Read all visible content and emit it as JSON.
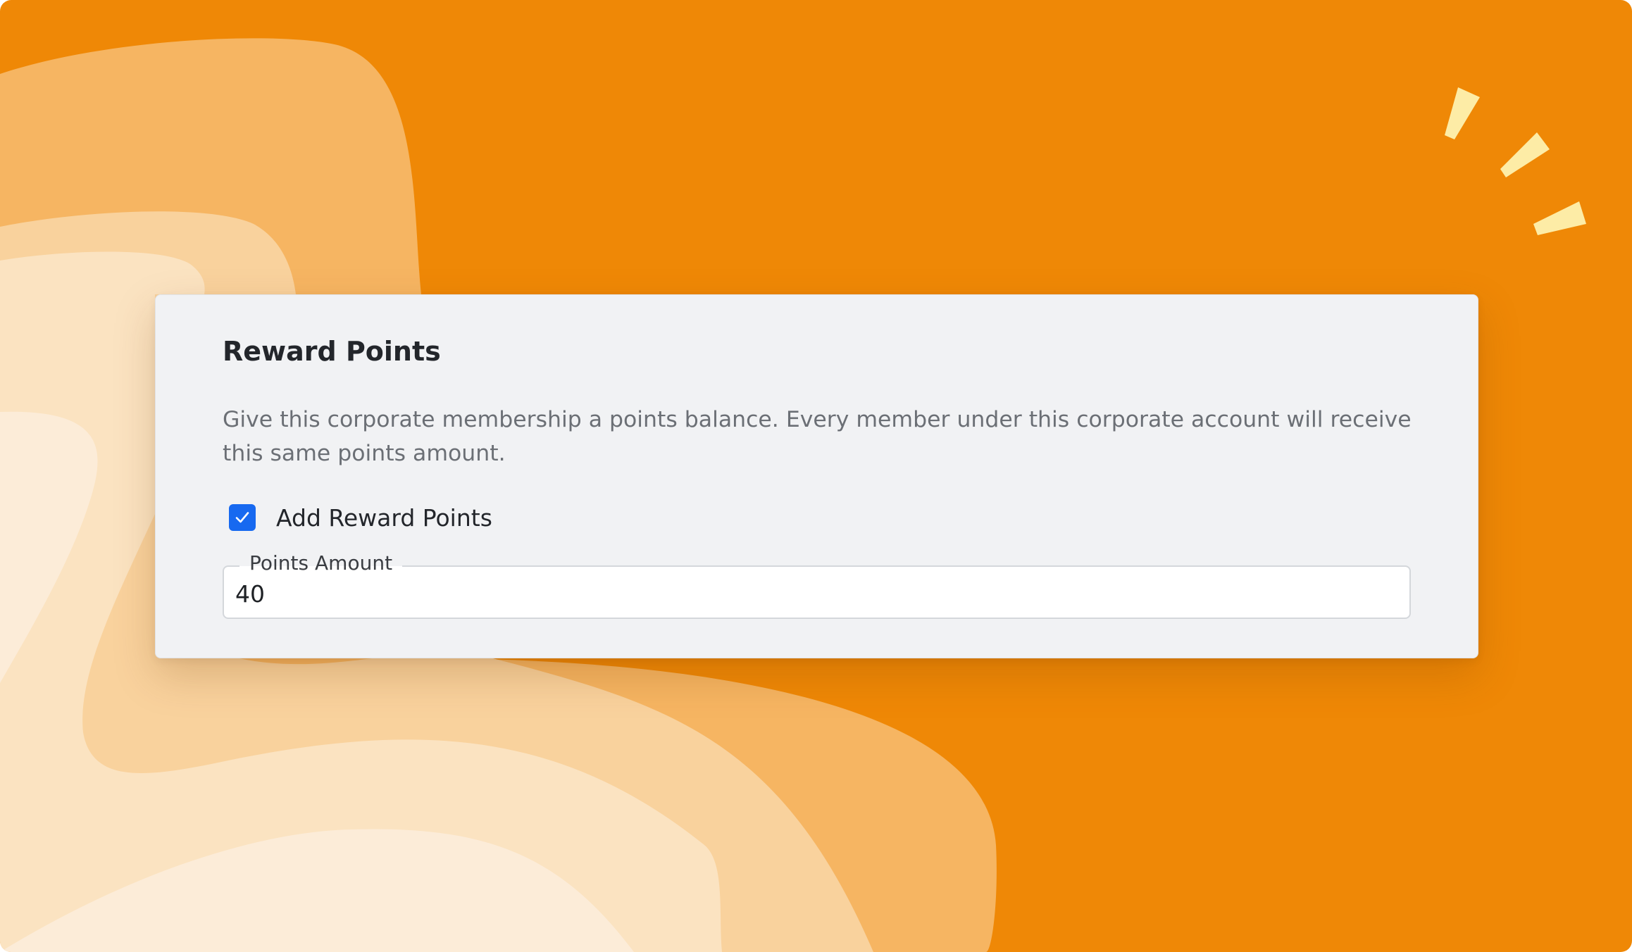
{
  "colors": {
    "background": "#ef8806",
    "card": "#f1f2f4",
    "accent": "#1769f0",
    "sparkle": "#fdeca6"
  },
  "card": {
    "title": "Reward Points",
    "description": "Give this corporate membership a points balance. Every member under this corporate account will receive this same points amount."
  },
  "add_points": {
    "label": "Add Reward Points",
    "checked": true
  },
  "points_amount": {
    "label": "Points Amount",
    "value": "40"
  },
  "icons": {
    "checkbox": "checkmark-icon",
    "decoration": "sparkle-icon"
  }
}
